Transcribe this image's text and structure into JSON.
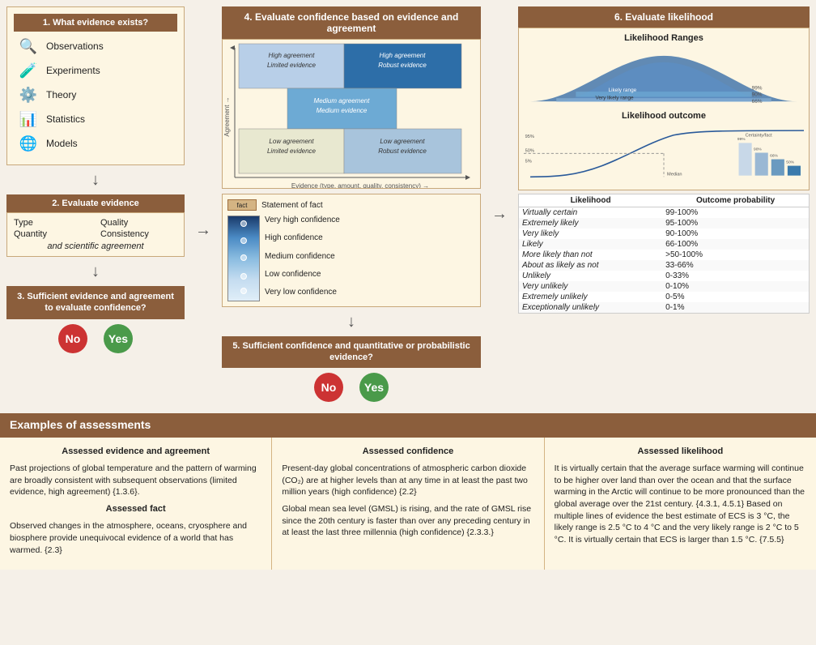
{
  "header": {
    "step1": "1. What evidence exists?",
    "step2": "2. Evaluate evidence",
    "step3": "3. Sufficient evidence and agreement to evaluate confidence?",
    "step4": "4. Evaluate confidence based on evidence and agreement",
    "step5": "5. Sufficient confidence and quantitative or probabilistic evidence?",
    "step6": "6. Evaluate likelihood"
  },
  "evidence_types": [
    {
      "icon": "🔍",
      "label": "Observations"
    },
    {
      "icon": "🧪",
      "label": "Experiments"
    },
    {
      "icon": "⚙️",
      "label": "Theory"
    },
    {
      "icon": "📊",
      "label": "Statistics"
    },
    {
      "icon": "🌐",
      "label": "Models"
    }
  ],
  "criteria": {
    "items": [
      "Type",
      "Quality",
      "Quantity",
      "Consistency"
    ],
    "and": "and scientific agreement"
  },
  "yesno": {
    "no": "No",
    "yes": "Yes"
  },
  "confidence_labels": [
    "Statement of fact",
    "Very high confidence",
    "High confidence",
    "Medium confidence",
    "Low confidence",
    "Very low confidence"
  ],
  "likelihood_table": {
    "headers": [
      "Likelihood",
      "Outcome probability"
    ],
    "rows": [
      [
        "Virtually certain",
        "99-100%"
      ],
      [
        "Extremely likely",
        "95-100%"
      ],
      [
        "Very likely",
        "90-100%"
      ],
      [
        "Likely",
        "66-100%"
      ],
      [
        "More likely than not",
        ">50-100%"
      ],
      [
        "About as likely as not",
        "33-66%"
      ],
      [
        "Unlikely",
        "0-33%"
      ],
      [
        "Very unlikely",
        "0-10%"
      ],
      [
        "Extremely unlikely",
        "0-5%"
      ],
      [
        "Exceptionally unlikely",
        "0-1%"
      ]
    ]
  },
  "matrix_cells": {
    "top_left": "High agreement Limited evidence",
    "top_right": "High agreement Robust evidence",
    "mid_center": "Medium agreement Medium evidence",
    "bot_left": "Low agreement Limited evidence",
    "bot_right": "Low agreement Robust evidence"
  },
  "likelihood_ranges": {
    "title": "Likelihood Ranges",
    "bands": [
      "99%",
      "90%",
      "66%"
    ],
    "labels": [
      "Likely range",
      "Very likely range"
    ]
  },
  "likelihood_outcome": {
    "title": "Likelihood outcome"
  },
  "examples_title": "Examples of assessments",
  "col1_title": "Assessed evidence and agreement",
  "col1_text1": "Past projections of global temperature and the pattern of warming are broadly consistent with subsequent observations (limited evidence, high agreement) {1.3.6}.",
  "col1_title2": "Assessed fact",
  "col1_text2": "Observed changes in the atmosphere, oceans, cryosphere and biosphere provide unequivocal evidence of a world that has warmed. {2.3}",
  "col2_title": "Assessed confidence",
  "col2_text1": "Present-day global concentrations of atmospheric carbon dioxide (CO₂) are at higher levels than at any time in at least the past two million years (high confidence) {2.2}",
  "col2_text2": "Global mean sea level (GMSL) is rising, and the rate of GMSL rise since the 20th century is faster than over any preceding century in at least the last three millennia (high confidence) {2.3.3.}",
  "col3_title": "Assessed likelihood",
  "col3_text": "It is virtually certain that the average surface warming will continue to be higher over land than over the ocean and that the surface warming in the Arctic will continue to be more pronounced than the global average over the 21st century. {4.3.1, 4.5.1}\n\nBased on multiple lines of evidence the best estimate of ECS is 3 °C, the likely range is 2.5 °C to 4 °C and the very likely range is 2 °C to 5 °C. It is virtually certain that ECS is larger than 1.5 °C. {7.5.5}"
}
